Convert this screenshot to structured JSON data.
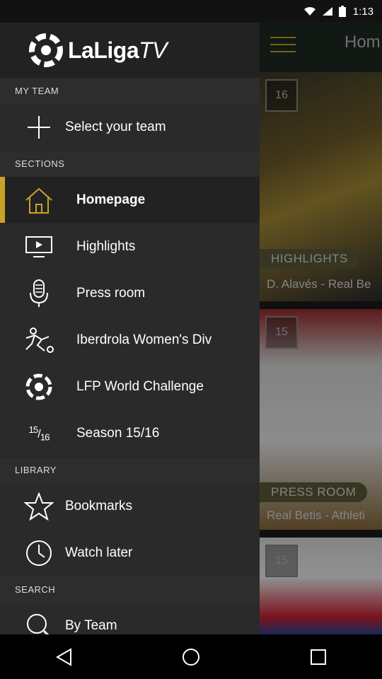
{
  "status_bar": {
    "time": "1:13"
  },
  "drawer": {
    "logo": {
      "text_main": "LaLiga",
      "text_suffix": "TV"
    },
    "sections": {
      "my_team_label": "MY TEAM",
      "select_team_label": "Select your team",
      "sections_label": "SECTIONS",
      "library_label": "LIBRARY",
      "search_label": "SEARCH"
    },
    "items": [
      {
        "label": "Homepage",
        "icon": "home-icon"
      },
      {
        "label": "Highlights",
        "icon": "tv-icon"
      },
      {
        "label": "Press room",
        "icon": "microphone-icon"
      },
      {
        "label": "Iberdrola Women's Div",
        "icon": "soccer-player-icon"
      },
      {
        "label": "LFP World Challenge",
        "icon": "globe-ball-icon"
      },
      {
        "label": "Season 15/16",
        "icon": "season-icon",
        "glyph_top": "15",
        "glyph_bottom": "16"
      }
    ],
    "library": [
      {
        "label": "Bookmarks",
        "icon": "star-icon"
      },
      {
        "label": "Watch later",
        "icon": "clock-icon"
      }
    ],
    "search": [
      {
        "label": "By Team",
        "icon": "search-icon"
      }
    ],
    "colors": {
      "accent": "#c9a227"
    }
  },
  "main": {
    "title": "Hom",
    "cards": [
      {
        "date": "16",
        "category": "HIGHLIGHTS",
        "title": "D. Alavés - Real Be"
      },
      {
        "date": "15",
        "category": "PRESS ROOM",
        "title": "Real Betis - Athleti"
      },
      {
        "date": "15"
      }
    ]
  }
}
